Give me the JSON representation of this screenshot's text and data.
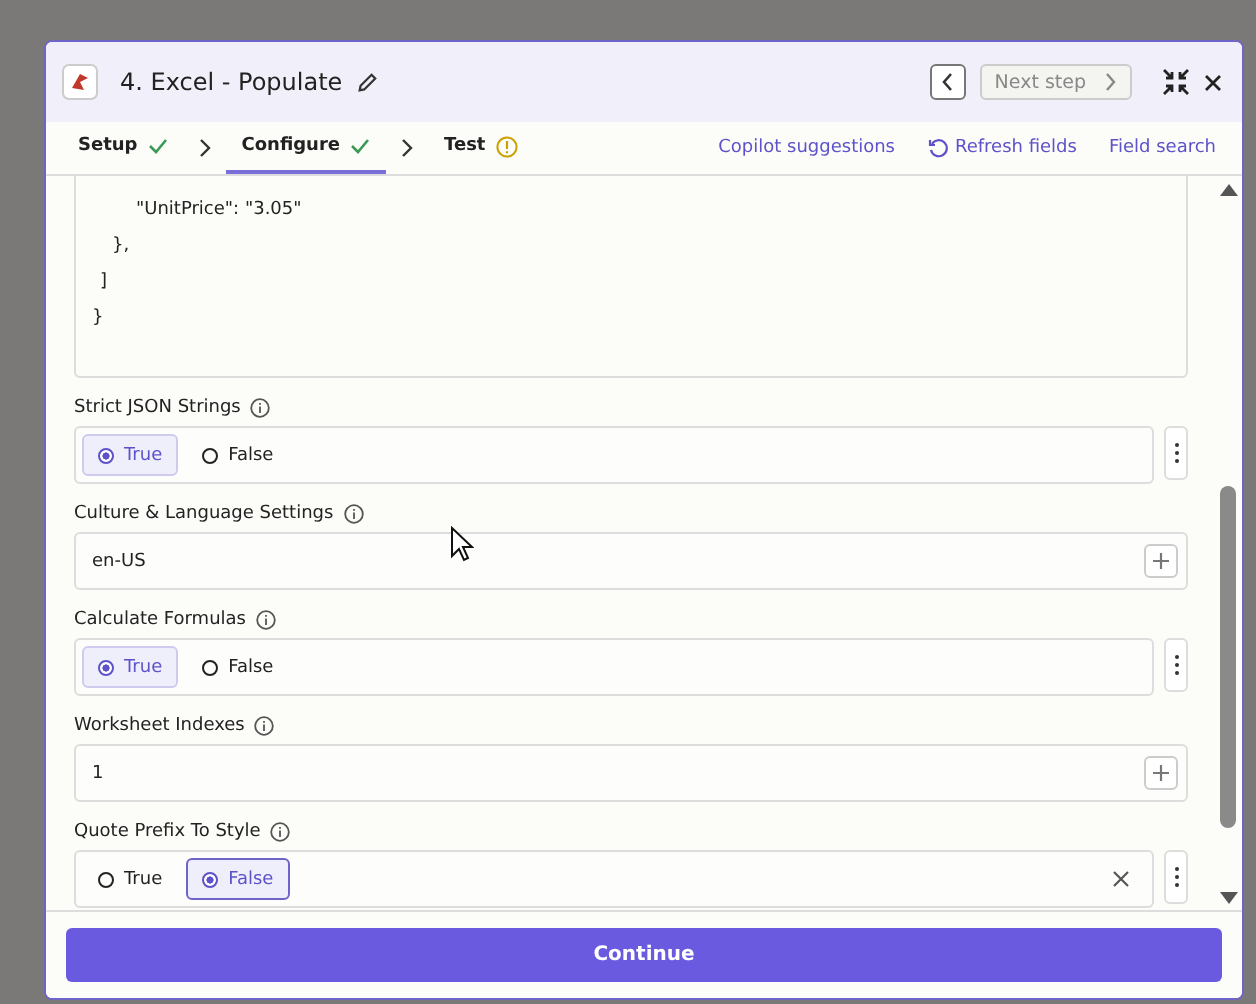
{
  "header": {
    "title": "4. Excel - Populate",
    "next_step": {
      "label": "Next step",
      "disabled": true
    }
  },
  "steps": [
    {
      "label": "Setup",
      "complete": true,
      "selected": false
    },
    {
      "label": "Configure",
      "complete": true,
      "selected": true
    },
    {
      "label": "Test",
      "complete": false,
      "selected": false
    }
  ],
  "actions": [
    "Copilot suggestions",
    "Refresh fields",
    "Field search"
  ],
  "code_lines": [
    {
      "text": "\"UnitPrice\": \"3.05\""
    },
    {
      "text": "},"
    },
    {
      "text": "]"
    },
    {
      "text": "}"
    }
  ],
  "fields": [
    {
      "kind": "radio",
      "label": "Strict JSON Strings",
      "clearable": false,
      "options": [
        {
          "label": "True",
          "selected": true
        },
        {
          "label": "False",
          "selected": false
        }
      ]
    },
    {
      "kind": "text",
      "label": "Culture & Language Settings",
      "value": "en-US"
    },
    {
      "kind": "radio",
      "label": "Calculate Formulas",
      "clearable": false,
      "options": [
        {
          "label": "True",
          "selected": true
        },
        {
          "label": "False",
          "selected": false
        }
      ]
    },
    {
      "kind": "text",
      "label": "Worksheet Indexes",
      "value": "1"
    },
    {
      "kind": "radio",
      "label": "Quote Prefix To Style",
      "clearable": true,
      "options": [
        {
          "label": "True",
          "selected": false
        },
        {
          "label": "False",
          "selected": true
        }
      ]
    }
  ],
  "footer": {
    "button": "Continue"
  }
}
